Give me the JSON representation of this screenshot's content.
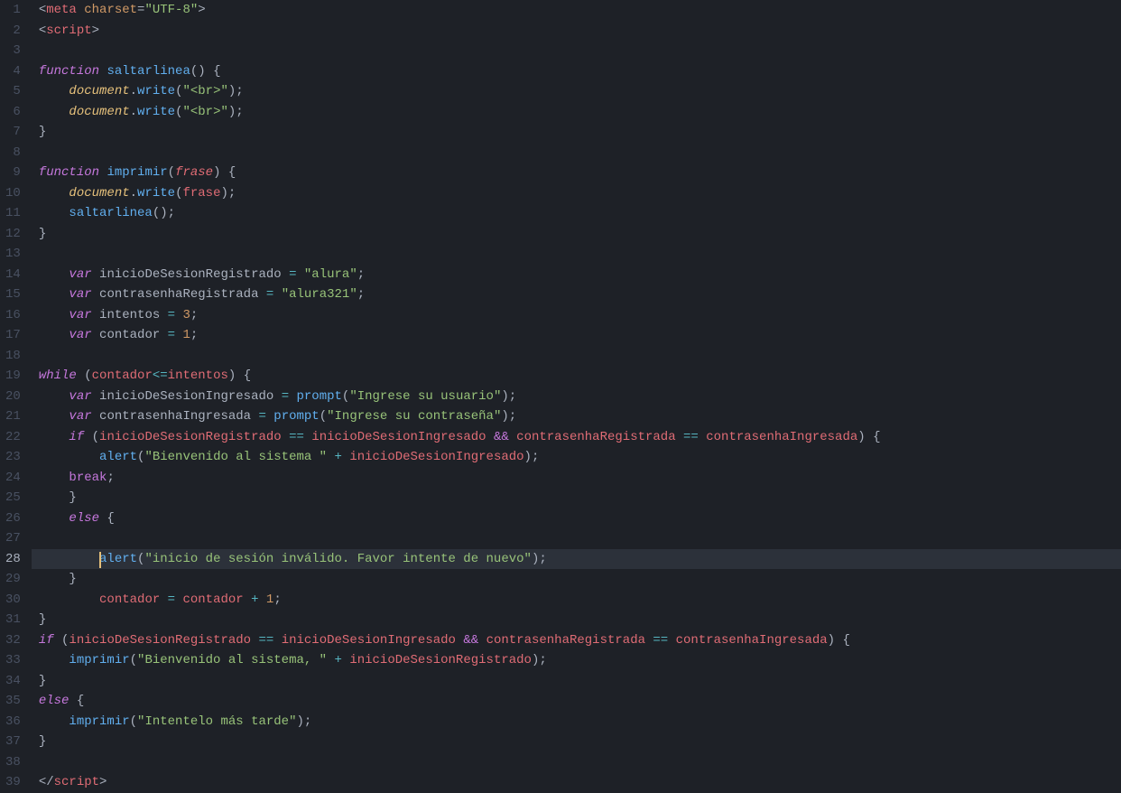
{
  "editor": {
    "activeLine": 28,
    "gutter": [
      "1",
      "2",
      "3",
      "4",
      "5",
      "6",
      "7",
      "8",
      "9",
      "10",
      "11",
      "12",
      "13",
      "14",
      "15",
      "16",
      "17",
      "18",
      "19",
      "20",
      "21",
      "22",
      "23",
      "24",
      "25",
      "26",
      "27",
      "28",
      "29",
      "30",
      "31",
      "32",
      "33",
      "34",
      "35",
      "36",
      "37",
      "38",
      "39"
    ],
    "lines": [
      [
        {
          "t": "<",
          "c": "c-tag"
        },
        {
          "t": "meta",
          "c": "c-tagname"
        },
        {
          "t": " ",
          "c": "c-plain"
        },
        {
          "t": "charset",
          "c": "c-attr"
        },
        {
          "t": "=",
          "c": "c-punct"
        },
        {
          "t": "\"UTF-8\"",
          "c": "c-string"
        },
        {
          "t": ">",
          "c": "c-tag"
        }
      ],
      [
        {
          "t": "<",
          "c": "c-tag"
        },
        {
          "t": "script",
          "c": "c-tagname"
        },
        {
          "t": ">",
          "c": "c-tag"
        }
      ],
      [],
      [
        {
          "t": "function",
          "c": "c-keyword"
        },
        {
          "t": " ",
          "c": "c-plain"
        },
        {
          "t": "saltarlinea",
          "c": "c-fn"
        },
        {
          "t": "() {",
          "c": "c-punct"
        }
      ],
      [
        {
          "t": "    ",
          "c": "c-plain"
        },
        {
          "t": "document",
          "c": "c-var"
        },
        {
          "t": ".",
          "c": "c-punct"
        },
        {
          "t": "write",
          "c": "c-fn"
        },
        {
          "t": "(",
          "c": "c-punct"
        },
        {
          "t": "\"<br>\"",
          "c": "c-string"
        },
        {
          "t": ");",
          "c": "c-punct"
        }
      ],
      [
        {
          "t": "    ",
          "c": "c-plain"
        },
        {
          "t": "document",
          "c": "c-var"
        },
        {
          "t": ".",
          "c": "c-punct"
        },
        {
          "t": "write",
          "c": "c-fn"
        },
        {
          "t": "(",
          "c": "c-punct"
        },
        {
          "t": "\"<br>\"",
          "c": "c-string"
        },
        {
          "t": ");",
          "c": "c-punct"
        }
      ],
      [
        {
          "t": "}",
          "c": "c-punct"
        }
      ],
      [],
      [
        {
          "t": "function",
          "c": "c-keyword"
        },
        {
          "t": " ",
          "c": "c-plain"
        },
        {
          "t": "imprimir",
          "c": "c-fn"
        },
        {
          "t": "(",
          "c": "c-punct"
        },
        {
          "t": "frase",
          "c": "c-param"
        },
        {
          "t": ") {",
          "c": "c-punct"
        }
      ],
      [
        {
          "t": "    ",
          "c": "c-plain"
        },
        {
          "t": "document",
          "c": "c-var"
        },
        {
          "t": ".",
          "c": "c-punct"
        },
        {
          "t": "write",
          "c": "c-fn"
        },
        {
          "t": "(",
          "c": "c-punct"
        },
        {
          "t": "frase",
          "c": "c-ident"
        },
        {
          "t": ");",
          "c": "c-punct"
        }
      ],
      [
        {
          "t": "    ",
          "c": "c-plain"
        },
        {
          "t": "saltarlinea",
          "c": "c-fn"
        },
        {
          "t": "();",
          "c": "c-punct"
        }
      ],
      [
        {
          "t": "}",
          "c": "c-punct"
        }
      ],
      [],
      [
        {
          "t": "    ",
          "c": "c-plain"
        },
        {
          "t": "var",
          "c": "c-storage"
        },
        {
          "t": " ",
          "c": "c-plain"
        },
        {
          "t": "inicioDeSesionRegistrado",
          "c": "c-plain"
        },
        {
          "t": " ",
          "c": "c-plain"
        },
        {
          "t": "=",
          "c": "c-op"
        },
        {
          "t": " ",
          "c": "c-plain"
        },
        {
          "t": "\"alura\"",
          "c": "c-string"
        },
        {
          "t": ";",
          "c": "c-punct"
        }
      ],
      [
        {
          "t": "    ",
          "c": "c-plain"
        },
        {
          "t": "var",
          "c": "c-storage"
        },
        {
          "t": " ",
          "c": "c-plain"
        },
        {
          "t": "contrasenhaRegistrada",
          "c": "c-plain"
        },
        {
          "t": " ",
          "c": "c-plain"
        },
        {
          "t": "=",
          "c": "c-op"
        },
        {
          "t": " ",
          "c": "c-plain"
        },
        {
          "t": "\"alura321\"",
          "c": "c-string"
        },
        {
          "t": ";",
          "c": "c-punct"
        }
      ],
      [
        {
          "t": "    ",
          "c": "c-plain"
        },
        {
          "t": "var",
          "c": "c-storage"
        },
        {
          "t": " ",
          "c": "c-plain"
        },
        {
          "t": "intentos",
          "c": "c-plain"
        },
        {
          "t": " ",
          "c": "c-plain"
        },
        {
          "t": "=",
          "c": "c-op"
        },
        {
          "t": " ",
          "c": "c-plain"
        },
        {
          "t": "3",
          "c": "c-num"
        },
        {
          "t": ";",
          "c": "c-punct"
        }
      ],
      [
        {
          "t": "    ",
          "c": "c-plain"
        },
        {
          "t": "var",
          "c": "c-storage"
        },
        {
          "t": " ",
          "c": "c-plain"
        },
        {
          "t": "contador",
          "c": "c-plain"
        },
        {
          "t": " ",
          "c": "c-plain"
        },
        {
          "t": "=",
          "c": "c-op"
        },
        {
          "t": " ",
          "c": "c-plain"
        },
        {
          "t": "1",
          "c": "c-num"
        },
        {
          "t": ";",
          "c": "c-punct"
        }
      ],
      [],
      [
        {
          "t": "while",
          "c": "c-keyword"
        },
        {
          "t": " (",
          "c": "c-punct"
        },
        {
          "t": "contador",
          "c": "c-ident"
        },
        {
          "t": "<=",
          "c": "c-op"
        },
        {
          "t": "intentos",
          "c": "c-ident"
        },
        {
          "t": ") {",
          "c": "c-punct"
        }
      ],
      [
        {
          "t": "    ",
          "c": "c-plain"
        },
        {
          "t": "var",
          "c": "c-storage"
        },
        {
          "t": " ",
          "c": "c-plain"
        },
        {
          "t": "inicioDeSesionIngresado",
          "c": "c-plain"
        },
        {
          "t": " ",
          "c": "c-plain"
        },
        {
          "t": "=",
          "c": "c-op"
        },
        {
          "t": " ",
          "c": "c-plain"
        },
        {
          "t": "prompt",
          "c": "c-fn"
        },
        {
          "t": "(",
          "c": "c-punct"
        },
        {
          "t": "\"Ingrese su usuario\"",
          "c": "c-string"
        },
        {
          "t": ");",
          "c": "c-punct"
        }
      ],
      [
        {
          "t": "    ",
          "c": "c-plain"
        },
        {
          "t": "var",
          "c": "c-storage"
        },
        {
          "t": " ",
          "c": "c-plain"
        },
        {
          "t": "contrasenhaIngresada",
          "c": "c-plain"
        },
        {
          "t": " ",
          "c": "c-plain"
        },
        {
          "t": "=",
          "c": "c-op"
        },
        {
          "t": " ",
          "c": "c-plain"
        },
        {
          "t": "prompt",
          "c": "c-fn"
        },
        {
          "t": "(",
          "c": "c-punct"
        },
        {
          "t": "\"Ingrese su contraseña\"",
          "c": "c-string"
        },
        {
          "t": ");",
          "c": "c-punct"
        }
      ],
      [
        {
          "t": "    ",
          "c": "c-plain"
        },
        {
          "t": "if",
          "c": "c-keyword"
        },
        {
          "t": " (",
          "c": "c-punct"
        },
        {
          "t": "inicioDeSesionRegistrado",
          "c": "c-ident"
        },
        {
          "t": " ",
          "c": "c-plain"
        },
        {
          "t": "==",
          "c": "c-op"
        },
        {
          "t": " ",
          "c": "c-plain"
        },
        {
          "t": "inicioDeSesionIngresado",
          "c": "c-ident"
        },
        {
          "t": " ",
          "c": "c-plain"
        },
        {
          "t": "&&",
          "c": "c-logop"
        },
        {
          "t": " ",
          "c": "c-plain"
        },
        {
          "t": "contrasenhaRegistrada",
          "c": "c-ident"
        },
        {
          "t": " ",
          "c": "c-plain"
        },
        {
          "t": "==",
          "c": "c-op"
        },
        {
          "t": " ",
          "c": "c-plain"
        },
        {
          "t": "contrasenhaIngresada",
          "c": "c-ident"
        },
        {
          "t": ") {",
          "c": "c-punct"
        }
      ],
      [
        {
          "t": "        ",
          "c": "c-plain"
        },
        {
          "t": "alert",
          "c": "c-fn"
        },
        {
          "t": "(",
          "c": "c-punct"
        },
        {
          "t": "\"Bienvenido al sistema \"",
          "c": "c-string"
        },
        {
          "t": " ",
          "c": "c-plain"
        },
        {
          "t": "+",
          "c": "c-op"
        },
        {
          "t": " ",
          "c": "c-plain"
        },
        {
          "t": "inicioDeSesionIngresado",
          "c": "c-ident"
        },
        {
          "t": ");",
          "c": "c-punct"
        }
      ],
      [
        {
          "t": "    ",
          "c": "c-plain"
        },
        {
          "t": "break",
          "c": "c-break"
        },
        {
          "t": ";",
          "c": "c-punct"
        }
      ],
      [
        {
          "t": "    }",
          "c": "c-punct"
        }
      ],
      [
        {
          "t": "    ",
          "c": "c-plain"
        },
        {
          "t": "else",
          "c": "c-keyword"
        },
        {
          "t": " {",
          "c": "c-punct"
        }
      ],
      [],
      [
        {
          "t": "        ",
          "c": "c-plain"
        },
        {
          "cursor": true
        },
        {
          "t": "alert",
          "c": "c-fn"
        },
        {
          "t": "(",
          "c": "c-punct"
        },
        {
          "t": "\"inicio de sesión inválido. Favor intente de nuevo\"",
          "c": "c-string"
        },
        {
          "t": ");",
          "c": "c-punct"
        }
      ],
      [
        {
          "t": "    }",
          "c": "c-punct"
        }
      ],
      [
        {
          "t": "        ",
          "c": "c-plain"
        },
        {
          "t": "contador",
          "c": "c-ident"
        },
        {
          "t": " ",
          "c": "c-plain"
        },
        {
          "t": "=",
          "c": "c-op"
        },
        {
          "t": " ",
          "c": "c-plain"
        },
        {
          "t": "contador",
          "c": "c-ident"
        },
        {
          "t": " ",
          "c": "c-plain"
        },
        {
          "t": "+",
          "c": "c-op"
        },
        {
          "t": " ",
          "c": "c-plain"
        },
        {
          "t": "1",
          "c": "c-num"
        },
        {
          "t": ";",
          "c": "c-punct"
        }
      ],
      [
        {
          "t": "}",
          "c": "c-punct"
        }
      ],
      [
        {
          "t": "if",
          "c": "c-keyword"
        },
        {
          "t": " (",
          "c": "c-punct"
        },
        {
          "t": "inicioDeSesionRegistrado",
          "c": "c-ident"
        },
        {
          "t": " ",
          "c": "c-plain"
        },
        {
          "t": "==",
          "c": "c-op"
        },
        {
          "t": " ",
          "c": "c-plain"
        },
        {
          "t": "inicioDeSesionIngresado",
          "c": "c-ident"
        },
        {
          "t": " ",
          "c": "c-plain"
        },
        {
          "t": "&&",
          "c": "c-logop"
        },
        {
          "t": " ",
          "c": "c-plain"
        },
        {
          "t": "contrasenhaRegistrada",
          "c": "c-ident"
        },
        {
          "t": " ",
          "c": "c-plain"
        },
        {
          "t": "==",
          "c": "c-op"
        },
        {
          "t": " ",
          "c": "c-plain"
        },
        {
          "t": "contrasenhaIngresada",
          "c": "c-ident"
        },
        {
          "t": ") {",
          "c": "c-punct"
        }
      ],
      [
        {
          "t": "    ",
          "c": "c-plain"
        },
        {
          "t": "imprimir",
          "c": "c-fn"
        },
        {
          "t": "(",
          "c": "c-punct"
        },
        {
          "t": "\"Bienvenido al sistema, \"",
          "c": "c-string"
        },
        {
          "t": " ",
          "c": "c-plain"
        },
        {
          "t": "+",
          "c": "c-op"
        },
        {
          "t": " ",
          "c": "c-plain"
        },
        {
          "t": "inicioDeSesionRegistrado",
          "c": "c-ident"
        },
        {
          "t": ");",
          "c": "c-punct"
        }
      ],
      [
        {
          "t": "}",
          "c": "c-punct"
        }
      ],
      [
        {
          "t": "else",
          "c": "c-keyword"
        },
        {
          "t": " {",
          "c": "c-punct"
        }
      ],
      [
        {
          "t": "    ",
          "c": "c-plain"
        },
        {
          "t": "imprimir",
          "c": "c-fn"
        },
        {
          "t": "(",
          "c": "c-punct"
        },
        {
          "t": "\"Intentelo más tarde\"",
          "c": "c-string"
        },
        {
          "t": ");",
          "c": "c-punct"
        }
      ],
      [
        {
          "t": "}",
          "c": "c-punct"
        }
      ],
      [],
      [
        {
          "t": "</",
          "c": "c-tag"
        },
        {
          "t": "script",
          "c": "c-tagname"
        },
        {
          "t": ">",
          "c": "c-tag"
        }
      ]
    ]
  }
}
